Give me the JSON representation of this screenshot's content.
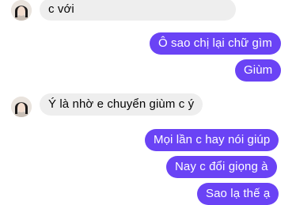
{
  "conversation": {
    "messages": [
      {
        "sender": "contact",
        "text": "c với"
      },
      {
        "sender": "me",
        "text": "Ô sao chị lại chữ gìm"
      },
      {
        "sender": "me",
        "text": "Giùm"
      },
      {
        "sender": "contact",
        "text": "Ý là nhờ e chuyển giùm c ý"
      },
      {
        "sender": "me",
        "text": "Mọi lần c hay nói giúp"
      },
      {
        "sender": "me",
        "text": "Nay c đổi giọng à"
      },
      {
        "sender": "me",
        "text": "Sao lạ thế ạ"
      }
    ]
  },
  "colors": {
    "outgoing_bubble": "#6a43f5",
    "incoming_bubble": "#eeeeee",
    "outgoing_text": "#ffffff",
    "incoming_text": "#050505"
  },
  "icons": {
    "contact_avatar": "contact-avatar-photo"
  }
}
